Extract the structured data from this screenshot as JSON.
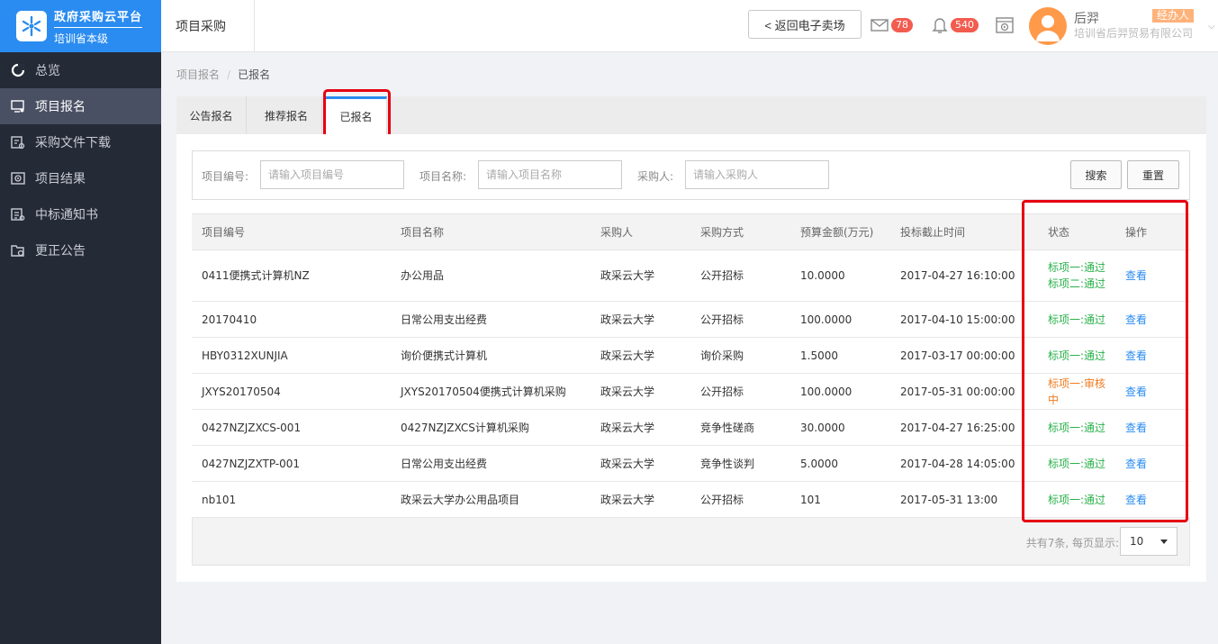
{
  "brand": {
    "title": "政府采购云平台",
    "subtitle": "培训省本级"
  },
  "sidebar": {
    "items": [
      {
        "label": "总览",
        "icon": "dashboard-icon"
      },
      {
        "label": "项目报名",
        "icon": "monitor-icon",
        "active": true
      },
      {
        "label": "采购文件下载",
        "icon": "file-download-icon"
      },
      {
        "label": "项目结果",
        "icon": "result-icon"
      },
      {
        "label": "中标通知书",
        "icon": "notice-icon"
      },
      {
        "label": "更正公告",
        "icon": "correction-icon"
      }
    ]
  },
  "header": {
    "title": "项目采购",
    "back_label": "< 返回电子卖场",
    "mail_count": "78",
    "bell_count": "540",
    "user_name": "后羿",
    "user_role": "经办人",
    "user_org": "培训省后羿贸易有限公司"
  },
  "breadcrumb": {
    "parent": "项目报名",
    "separator": "/",
    "current": "已报名"
  },
  "tabs": [
    {
      "label": "公告报名"
    },
    {
      "label": "推荐报名"
    },
    {
      "label": "已报名",
      "active": true
    }
  ],
  "filters": {
    "project_no_label": "项目编号:",
    "project_no_placeholder": "请输入项目编号",
    "project_name_label": "项目名称:",
    "project_name_placeholder": "请输入项目名称",
    "buyer_label": "采购人:",
    "buyer_placeholder": "请输入采购人",
    "search_label": "搜索",
    "reset_label": "重置"
  },
  "table": {
    "headers": [
      "项目编号",
      "项目名称",
      "采购人",
      "采购方式",
      "预算金额(万元)",
      "投标截止时间",
      "状态",
      "操作"
    ],
    "rows": [
      {
        "no": "0411便携式计算机NZ",
        "name": "办公用品",
        "buyer": "政采云大学",
        "method": "公开招标",
        "budget": "10.0000",
        "deadline": "2017-04-27 16:10:00",
        "status": [
          "标项一:通过",
          "标项二:通过"
        ],
        "status_type": "pass",
        "action": "查看"
      },
      {
        "no": "20170410",
        "name": "日常公用支出经费",
        "buyer": "政采云大学",
        "method": "公开招标",
        "budget": "100.0000",
        "deadline": "2017-04-10 15:00:00",
        "status": [
          "标项一:通过"
        ],
        "status_type": "pass",
        "action": "查看"
      },
      {
        "no": "HBY0312XUNJIA",
        "name": "询价便携式计算机",
        "buyer": "政采云大学",
        "method": "询价采购",
        "budget": "1.5000",
        "deadline": "2017-03-17 00:00:00",
        "status": [
          "标项一:通过"
        ],
        "status_type": "pass",
        "action": "查看"
      },
      {
        "no": "JXYS20170504",
        "name": "JXYS20170504便携式计算机采购",
        "buyer": "政采云大学",
        "method": "公开招标",
        "budget": "100.0000",
        "deadline": "2017-05-31 00:00:00",
        "status": [
          "标项一:审核中"
        ],
        "status_type": "audit",
        "action": "查看"
      },
      {
        "no": "0427NZJZXCS-001",
        "name": "0427NZJZXCS计算机采购",
        "buyer": "政采云大学",
        "method": "竞争性磋商",
        "budget": "30.0000",
        "deadline": "2017-04-27 16:25:00",
        "status": [
          "标项一:通过"
        ],
        "status_type": "pass",
        "action": "查看"
      },
      {
        "no": "0427NZJZXTP-001",
        "name": "日常公用支出经费",
        "buyer": "政采云大学",
        "method": "竞争性谈判",
        "budget": "5.0000",
        "deadline": "2017-04-28 14:05:00",
        "status": [
          "标项一:通过"
        ],
        "status_type": "pass",
        "action": "查看"
      },
      {
        "no": "nb101",
        "name": "政采云大学办公用品项目",
        "buyer": "政采云大学",
        "method": "公开招标",
        "budget": "101",
        "deadline": "2017-05-31 13:00",
        "status": [
          "标项一:通过"
        ],
        "status_type": "pass",
        "action": "查看"
      }
    ]
  },
  "pager": {
    "summary": "共有7条, 每页显示:",
    "page_size": "10"
  },
  "colors": {
    "primary": "#2a8cf0",
    "sidebar": "#252a37",
    "pass": "#2ab04a",
    "audit": "#f07b1f",
    "highlight": "#e60012",
    "badge": "#f25c4f"
  }
}
